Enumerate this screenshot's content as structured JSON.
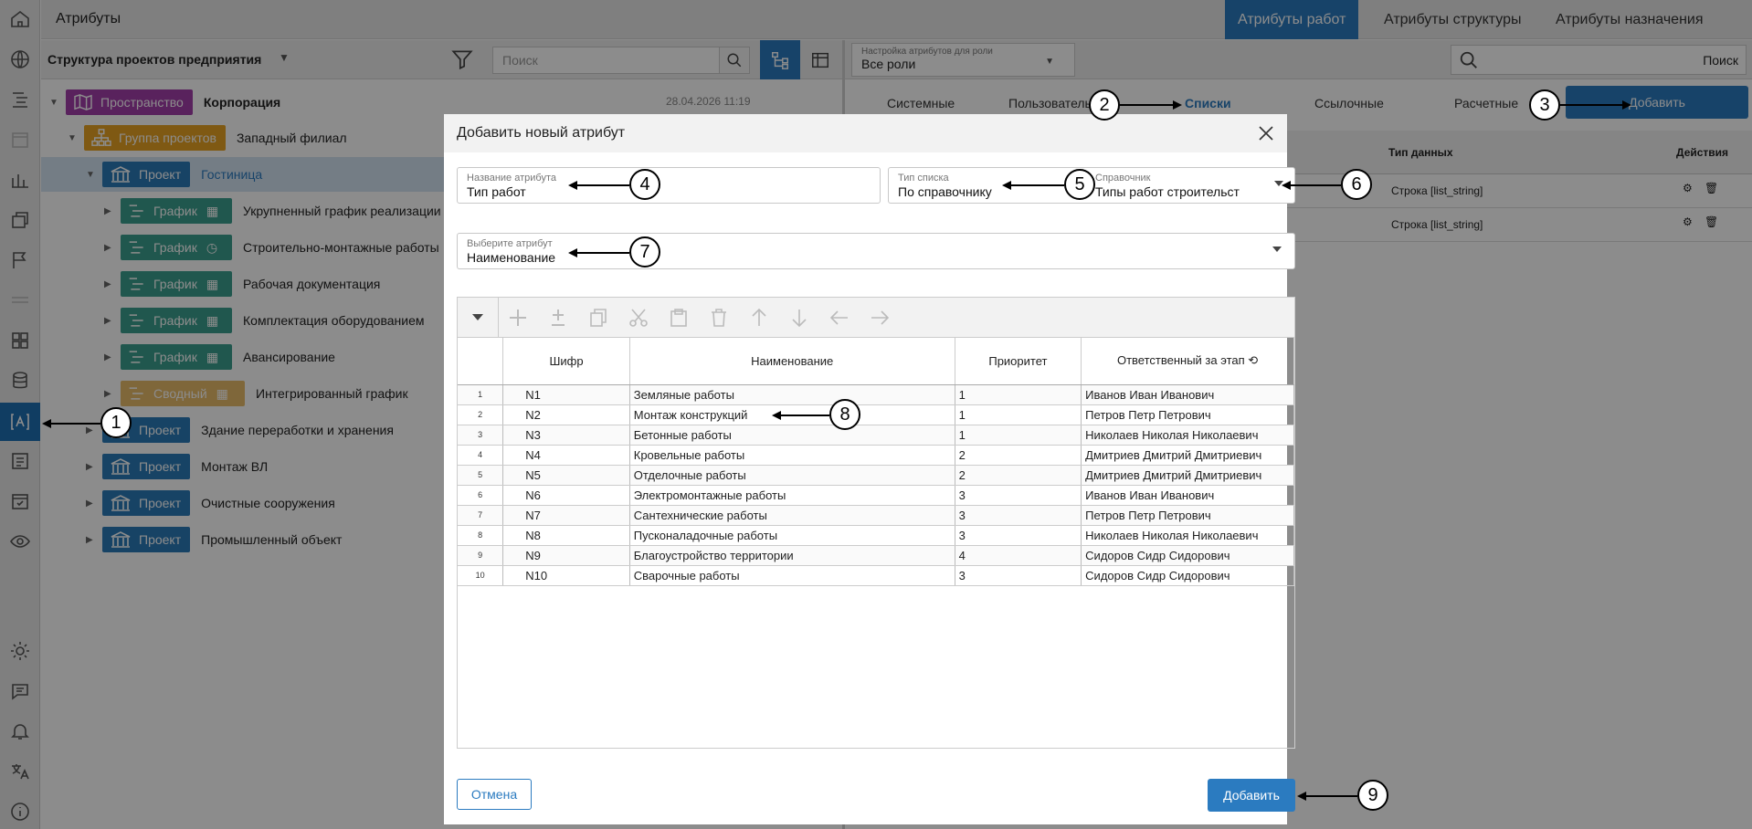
{
  "app": {
    "title": "Атрибуты"
  },
  "top_tabs": [
    {
      "label": "Атрибуты работ",
      "active": true
    },
    {
      "label": "Атрибуты структуры",
      "active": false
    },
    {
      "label": "Атрибуты назначения",
      "active": false
    }
  ],
  "left_panel": {
    "title": "Структура проектов предприятия",
    "search_placeholder": "Поиск",
    "date": "28.04.2026 11:19",
    "tree": [
      {
        "badge": "Пространство",
        "label": "Корпорация",
        "type": "space"
      },
      {
        "badge": "Группа проектов",
        "label": "Западный филиал",
        "type": "group"
      },
      {
        "badge": "Проект",
        "label": "Гостиница",
        "type": "project",
        "selected": true
      },
      {
        "badge": "График",
        "label": "Укрупненный график реализации",
        "type": "schedule"
      },
      {
        "badge": "График",
        "label": "Строительно-монтажные работы",
        "type": "schedule"
      },
      {
        "badge": "График",
        "label": "Рабочая документация",
        "type": "schedule"
      },
      {
        "badge": "График",
        "label": "Комплектация оборудованием",
        "type": "schedule"
      },
      {
        "badge": "График",
        "label": "Авансирование",
        "type": "schedule"
      },
      {
        "badge": "Сводный",
        "label": "Интегрированный график",
        "type": "summary"
      },
      {
        "badge": "Проект",
        "label": "Здание переработки и хранения",
        "type": "project"
      },
      {
        "badge": "Проект",
        "label": "Монтаж ВЛ",
        "type": "project"
      },
      {
        "badge": "Проект",
        "label": "Очистные сооружения",
        "type": "project"
      },
      {
        "badge": "Проект",
        "label": "Промышленный объект",
        "type": "project"
      }
    ]
  },
  "right_panel": {
    "role_label": "Настройка атрибутов для роли",
    "role_value": "Все роли",
    "search_label": "Поиск",
    "subtabs": [
      "Системные",
      "Пользовательские",
      "Списки",
      "Ссылочные",
      "Расчетные"
    ],
    "active_subtab": "Списки",
    "add_label": "Добавить",
    "col_type": "Тип данных",
    "col_actions": "Действия",
    "rows": [
      {
        "type": "Строка [list_string]"
      },
      {
        "type": "Строка [list_string]"
      }
    ]
  },
  "modal": {
    "title": "Добавить новый атрибут",
    "name_label": "Название атрибута",
    "name_value": "Тип работ",
    "list_type_label": "Тип списка",
    "list_type_value": "По справочнику",
    "dict_label": "Справочник",
    "dict_value": "Типы работ строительст",
    "attr_label": "Выберите атрибут",
    "attr_value": "Наименование",
    "columns": [
      "Шифр",
      "Наименование",
      "Приоритет",
      "Ответственный за этап"
    ],
    "rows": [
      {
        "n": "1",
        "code": "N1",
        "name": "Земляные работы",
        "prio": "1",
        "resp": "Иванов Иван Иванович"
      },
      {
        "n": "2",
        "code": "N2",
        "name": "Монтаж конструкций",
        "prio": "1",
        "resp": "Петров Петр Петрович"
      },
      {
        "n": "3",
        "code": "N3",
        "name": "Бетонные работы",
        "prio": "1",
        "resp": "Николаев Николая Николаевич"
      },
      {
        "n": "4",
        "code": "N4",
        "name": "Кровельные работы",
        "prio": "2",
        "resp": "Дмитриев Дмитрий Дмитриевич"
      },
      {
        "n": "5",
        "code": "N5",
        "name": "Отделочные работы",
        "prio": "2",
        "resp": "Дмитриев Дмитрий Дмитриевич"
      },
      {
        "n": "6",
        "code": "N6",
        "name": "Электромонтажные работы",
        "prio": "3",
        "resp": "Иванов Иван Иванович"
      },
      {
        "n": "7",
        "code": "N7",
        "name": "Сантехнические работы",
        "prio": "3",
        "resp": "Петров Петр Петрович"
      },
      {
        "n": "8",
        "code": "N8",
        "name": "Пусконаладочные работы",
        "prio": "3",
        "resp": "Николаев Николая Николаевич"
      },
      {
        "n": "9",
        "code": "N9",
        "name": "Благоустройство территории",
        "prio": "4",
        "resp": "Сидоров Сидр Сидорович"
      },
      {
        "n": "10",
        "code": "N10",
        "name": "Сварочные работы",
        "prio": "3",
        "resp": "Сидоров Сидр Сидорович"
      }
    ],
    "cancel_label": "Отмена",
    "add_label": "Добавить"
  },
  "callouts": [
    "1",
    "2",
    "3",
    "4",
    "5",
    "6",
    "7",
    "8",
    "9"
  ],
  "colors": {
    "accent": "#2b7bc0",
    "space": "#a33eaa",
    "group": "#e7a323",
    "project": "#2a7bb8",
    "schedule": "#3b9e8e",
    "summary": "#e8bc6a"
  }
}
